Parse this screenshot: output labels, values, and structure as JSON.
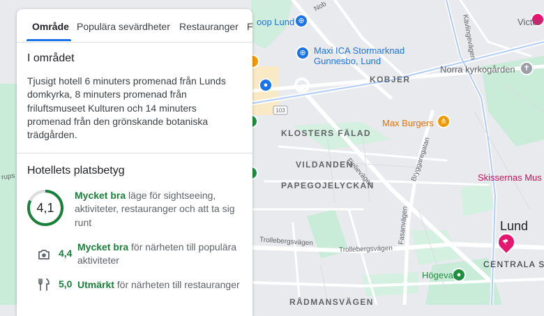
{
  "tabs": [
    "Område",
    "Populära sevärdheter",
    "Restauranger",
    "F"
  ],
  "area": {
    "title": "I området",
    "description": "Tjusigt hotell 6 minuters promenad från Lunds domkyrka, 8 minuters promenad från friluftsmuseet Kulturen och 14 minuters promenad från den grönskande botaniska trädgården."
  },
  "location_rating": {
    "title": "Hotellets platsbetyg",
    "score": "4,1",
    "score_fraction": 0.82,
    "quality": "Mycket bra",
    "text": " läge för sightseeing, aktiviteter, restauranger och att ta sig runt",
    "ring_color": "#188038",
    "items": [
      {
        "icon": "camera-icon",
        "score": "4,4",
        "quality": "Mycket bra",
        "text": " för närheten till populära aktiviteter"
      },
      {
        "icon": "restaurant-icon",
        "score": "5,0",
        "quality": "Utmärkt",
        "text": " för närheten till restauranger"
      }
    ]
  },
  "map": {
    "places": {
      "coop": "oop Lund",
      "ica_line1": "Maxi ICA Stormarknad",
      "ica_line2": "Gunnesbo, Lund",
      "max_burgers": "Max Burgers",
      "norra_kyrkogarden": "Norra kyrkogården",
      "hogevall": "Högevall",
      "skissernas": "Skissernas Mus",
      "lund": "Lund",
      "centrala": "CENTRALA S",
      "victor": "Victor"
    },
    "districts": {
      "kobjer": "KOBJER",
      "klosters_falad": "KLOSTERS FÄLAD",
      "vildanden": "VILDANDEN",
      "papegojelyckan": "PAPEGOJELYCKAN",
      "radmansvagen": "RÅDMANSVÄGEN"
    },
    "streets": {
      "fjelievagen": "Fjelievägen",
      "bryggaregatan": "Bryggaregatan",
      "trollebergsvagen_1": "Trollebergsvägen",
      "trollebergsvagen_2": "Trollebergsvägen",
      "fasanvagen": "Fasanvägen",
      "kavlingevagen": "Kävlingevägen",
      "nobel": "Nob",
      "rups": "rups"
    },
    "road_shield": "103",
    "colors": {
      "base": "#e8eaed",
      "park": "#c8ecd8",
      "road": "#ffffff",
      "pin_blue": "#1a73e8",
      "pin_orange": "#f29900",
      "pin_green": "#1e8e3e",
      "pin_magenta": "#e5166f"
    }
  }
}
